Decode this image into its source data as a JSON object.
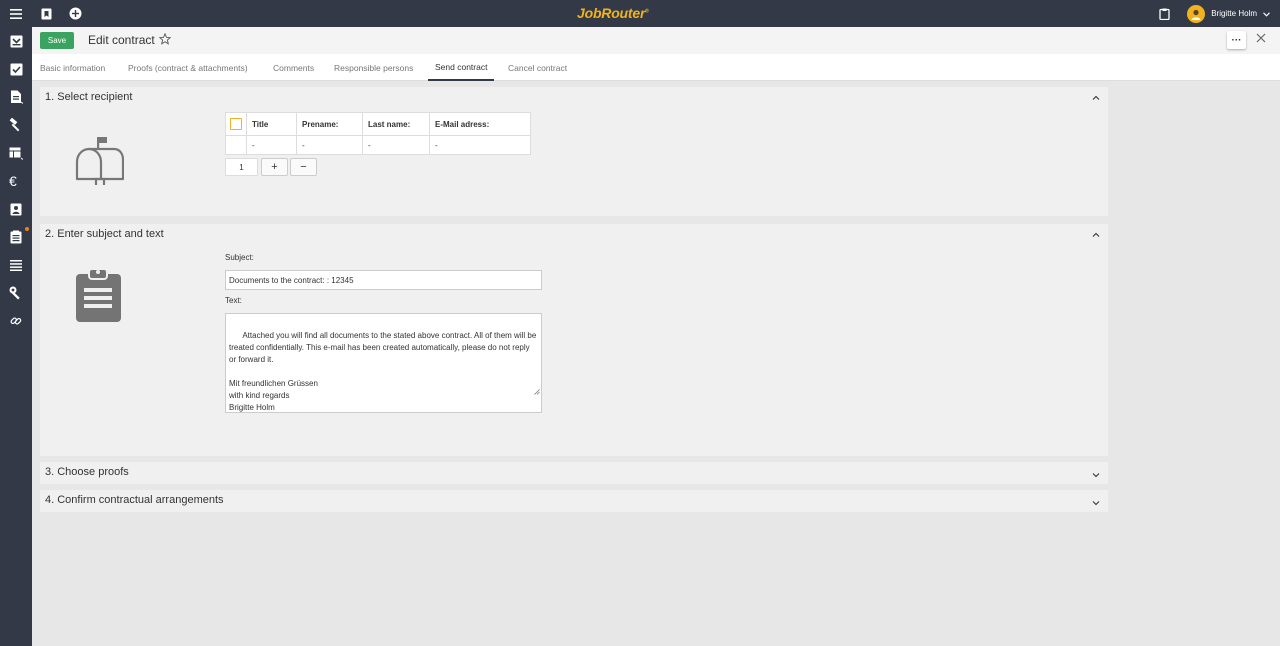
{
  "topbar": {
    "brand": "JobRouter",
    "brand_mark": "®",
    "user_name": "Brigitte Holm"
  },
  "header": {
    "save_label": "Save",
    "title": "Edit contract",
    "more_label": "···"
  },
  "tabs": [
    {
      "label": "Basic information"
    },
    {
      "label": "Proofs (contract & attachments)"
    },
    {
      "label": "Comments"
    },
    {
      "label": "Responsible persons"
    },
    {
      "label": "Send contract",
      "active": true
    },
    {
      "label": "Cancel contract"
    }
  ],
  "sections": {
    "recipient": {
      "title": "1. Select recipient",
      "columns": [
        "Title",
        "Prename:",
        "Last name:",
        "E-Mail adress:"
      ],
      "rows": [
        [
          "-",
          "-",
          "-",
          "-"
        ]
      ],
      "count": "1",
      "plus": "+",
      "minus": "−"
    },
    "subject": {
      "title": "2. Enter subject and text",
      "subject_label": "Subject:",
      "subject_value": "Documents to the contract: : 12345",
      "text_label": "Text:",
      "text_value": "Attached you will find all documents to the stated above contract. All of them will be treated confidentially. This e-mail has been created automatically, please do not reply or forward it.\n\nMit freundlichen Grüssen\nwith kind regards\nBrigitte Holm"
    },
    "proofs": {
      "title": "3. Choose proofs"
    },
    "confirm": {
      "title": "4. Confirm contractual arrangements"
    }
  },
  "colors": {
    "topbar": "#333947",
    "accent": "#f0b21d",
    "save": "#3aa35f",
    "notification": "#f07d1a"
  },
  "icons": {
    "topbar": [
      "menu-icon",
      "bookmark-icon",
      "add-circle-icon",
      "clipboard-icon",
      "chevron-down-icon"
    ],
    "sidebar": [
      "inbox-icon",
      "checkbox-icon",
      "document-icon",
      "hammer-icon",
      "table-icon",
      "euro-icon",
      "contact-icon",
      "clipboard-list-icon",
      "list-icon",
      "wrench-icon",
      "link-icon"
    ]
  }
}
